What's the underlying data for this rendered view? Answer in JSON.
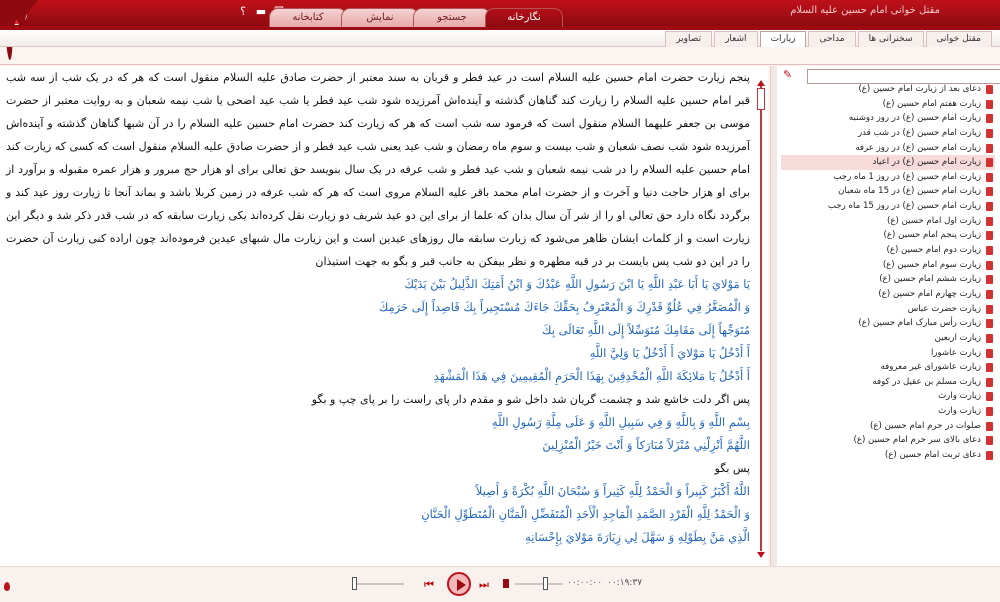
{
  "app": {
    "title": "مقتل خوانی امام حسین علیه السلام",
    "logo_label": "ش",
    "help_label": "؟"
  },
  "colors": {
    "accent": "#c0111b",
    "arabic_text": "#2266bb",
    "selected_row": "#f7dada"
  },
  "main_tabs": [
    {
      "label": "نگارخانه",
      "active": true
    },
    {
      "label": "جستجو"
    },
    {
      "label": "نمایش"
    },
    {
      "label": "کتابخانه"
    }
  ],
  "sub_tabs": [
    {
      "label": "مقتل خوانی"
    },
    {
      "label": "سخنرانی ها"
    },
    {
      "label": "مداحی"
    },
    {
      "label": "زیارات",
      "active": true
    },
    {
      "label": "اشعار"
    },
    {
      "label": "تصاویر"
    }
  ],
  "content": {
    "paragraphs": [
      {
        "text": "پنجم زیارت حضرت امام حسین علیه السلام است در عید فطر و قربان به سند معتبر از حضرت صادق علیه السلام منقول است که هر که در یک شب از سه شب قبر امام حسین علیه السلام را زیارت کند گناهان گذشته و آینده‌اش آمرزیده شود شب عید فطر یا شب عید اضحی یا شب نیمه شعبان و به روایت معتبر از حضرت موسی بن جعفر علیهما السلام منقول است که فرمود سه شب است که هر که زیارت کند حضرت امام حسین علیه السلام را در آن شبها گناهان گذشته و آینده‌اش آمرزیده شود شب نصف شعبان و شب بیست و سوم ماه رمضان و شب عید یعنی شب عید فطر و از حضرت صادق علیه السلام منقول است که کسی که زیارت کند امام حسین علیه السلام را در شب نیمه شعبان و شب عید فطر و شب عرفه در یک سال بنویسد حق تعالی برای او هزار حج مبرور و هزار عمره مقبوله و برآورد از برای او هزار حاجت دنیا و آخرت و از حضرت امام محمد باقر علیه السلام مروی است که هر که شب عرفه در زمین کربلا باشد و بماند آنجا تا زیارت روز عید کند و برگردد نگاه دارد حق تعالی او را از شر آن سال بدان که علما از برای این دو عید شریف دو زیارت نقل کرده‌اند یکی زیارت سابقه که در شب قدر ذکر شد و دیگر این زیارت است و از کلمات ایشان ظاهر می‌شود که زیارت سابقه مال روزهای عیدین است و این زیارت مال شبهای عیدین فرموده‌اند چون اراده کنی زیارت آن حضرت را در این دو شب پس بایست بر در قبه مطهره و نظر بیفکن به جانب قبر و بگو به جهت استیذان",
        "arabic": false
      },
      {
        "text": "يَا مَوْلايَ يَا أَبَا عَبْدِ اللَّهِ يَا ابْنَ رَسُولِ اللَّهِ عَبْدُكَ وَ ابْنُ أَمَتِكَ الذَّلِيلُ بَيْنَ يَدَيْكَ",
        "arabic": true
      },
      {
        "text": "وَ الْمُصَغَّرُ فِي عُلُوِّ قَدْرِكَ وَ الْمُعْتَرِفُ بِحَقِّكَ جَاءَكَ مُسْتَجِيراً بِكَ قَاصِداً إِلَى حَرَمِكَ",
        "arabic": true
      },
      {
        "text": "مُتَوَجِّهاً إِلَى مَقَامِكَ مُتَوَسِّلاً إِلَى اللَّهِ تَعَالَى بِكَ",
        "arabic": true
      },
      {
        "text": "أَ أَدْخُلُ يَا مَوْلايَ أَ أَدْخُلُ يَا وَلِيَّ اللَّهِ",
        "arabic": true
      },
      {
        "text": "أَ أَدْخُلُ يَا مَلائِكَةَ اللَّهِ الْمُحْدِقِينَ بِهَذَا الْحَرَمِ الْمُقِيمِينَ فِي هَذَا الْمَشْهَدِ",
        "arabic": true
      },
      {
        "text": "پس اگر دلت خاشع شد و چشمت گریان شد داخل شو و مقدم دار پای راست را بر پای چپ و بگو",
        "arabic": false
      },
      {
        "text": "بِسْمِ اللَّهِ وَ بِاللَّهِ وَ فِي سَبِيلِ اللَّهِ وَ عَلَى مِلَّةِ رَسُولِ اللَّهِ",
        "arabic": true
      },
      {
        "text": "اللَّهُمَّ أَنْزِلْنِي مُنْزَلاً مُبَارَكاً وَ أَنْتَ خَيْرُ الْمُنْزِلِينَ",
        "arabic": true
      },
      {
        "text": "پس بگو",
        "arabic": false
      },
      {
        "text": "اللَّهُ أَكْبَرُ كَبِيراً وَ الْحَمْدُ لِلَّهِ كَثِيراً وَ سُبْحَانَ اللَّهِ بُكْرَةً وَ أَصِيلاً",
        "arabic": true
      },
      {
        "text": "وَ الْحَمْدُ لِلَّهِ الْفَرْدِ الصَّمَدِ الْمَاجِدِ الْأَحَدِ الْمُتَفَضِّلِ الْمَنَّانِ الْمُتَطَوِّلِ الْحَنَّانِ",
        "arabic": true
      },
      {
        "text": "الَّذِي مَنَّ بِطَوْلِهِ وَ سَهَّلَ لِي زِيَارَةَ مَوْلايَ بِإِحْسَانِهِ",
        "arabic": true
      }
    ]
  },
  "sidebar": {
    "search_placeholder": "",
    "search_icon": "search-icon",
    "items": [
      {
        "label": "دعای بعد از زیارت امام حسین (ع)"
      },
      {
        "label": "زیارت هفتم امام حسین (ع)"
      },
      {
        "label": "زیارت امام حسین (ع) در روز دوشنبه"
      },
      {
        "label": "زیارت امام حسین (ع) در شب قدر"
      },
      {
        "label": "زیارت امام حسین (ع) در روز عرفه"
      },
      {
        "label": "زیارت امام حسین (ع) در اعیاد",
        "selected": true
      },
      {
        "label": "زیارت امام حسین (ع) در روز 1 ماه رجب"
      },
      {
        "label": "زیارت امام حسین (ع) در 15 ماه شعبان"
      },
      {
        "label": "زیارت امام حسین (ع) در روز 15 ماه رجب"
      },
      {
        "label": "زیارت اول امام حسین (ع)"
      },
      {
        "label": "زیارت پنجم امام حسین (ع)"
      },
      {
        "label": "زیارت دوم امام حسین (ع)"
      },
      {
        "label": "زیارت سوم امام حسین (ع)"
      },
      {
        "label": "زیارت ششم امام حسین (ع)"
      },
      {
        "label": "زیارت چهارم امام حسین (ع)"
      },
      {
        "label": "زیارت حضرت عباس"
      },
      {
        "label": "زیارت رأس مبارک امام حسین (ع)"
      },
      {
        "label": "زیارت اربعین"
      },
      {
        "label": "زیارت عاشورا"
      },
      {
        "label": "زیارت عاشورای غیر معروفه"
      },
      {
        "label": "زیارت مسلم بن عقیل در کوفه"
      },
      {
        "label": "زیارت وارث"
      },
      {
        "label": "زیارت وارث"
      },
      {
        "label": "صلوات در حرم امام حسین (ع)"
      },
      {
        "label": "دعای بالای سر حرم امام حسین (ع)"
      },
      {
        "label": "دعای تربت امام حسین (ع)"
      }
    ]
  },
  "player": {
    "elapsed": "۰۰:۰۰:۰۰",
    "total": "۰۰:۱۹:۳۷",
    "progress": 0,
    "volume": 0.6
  }
}
